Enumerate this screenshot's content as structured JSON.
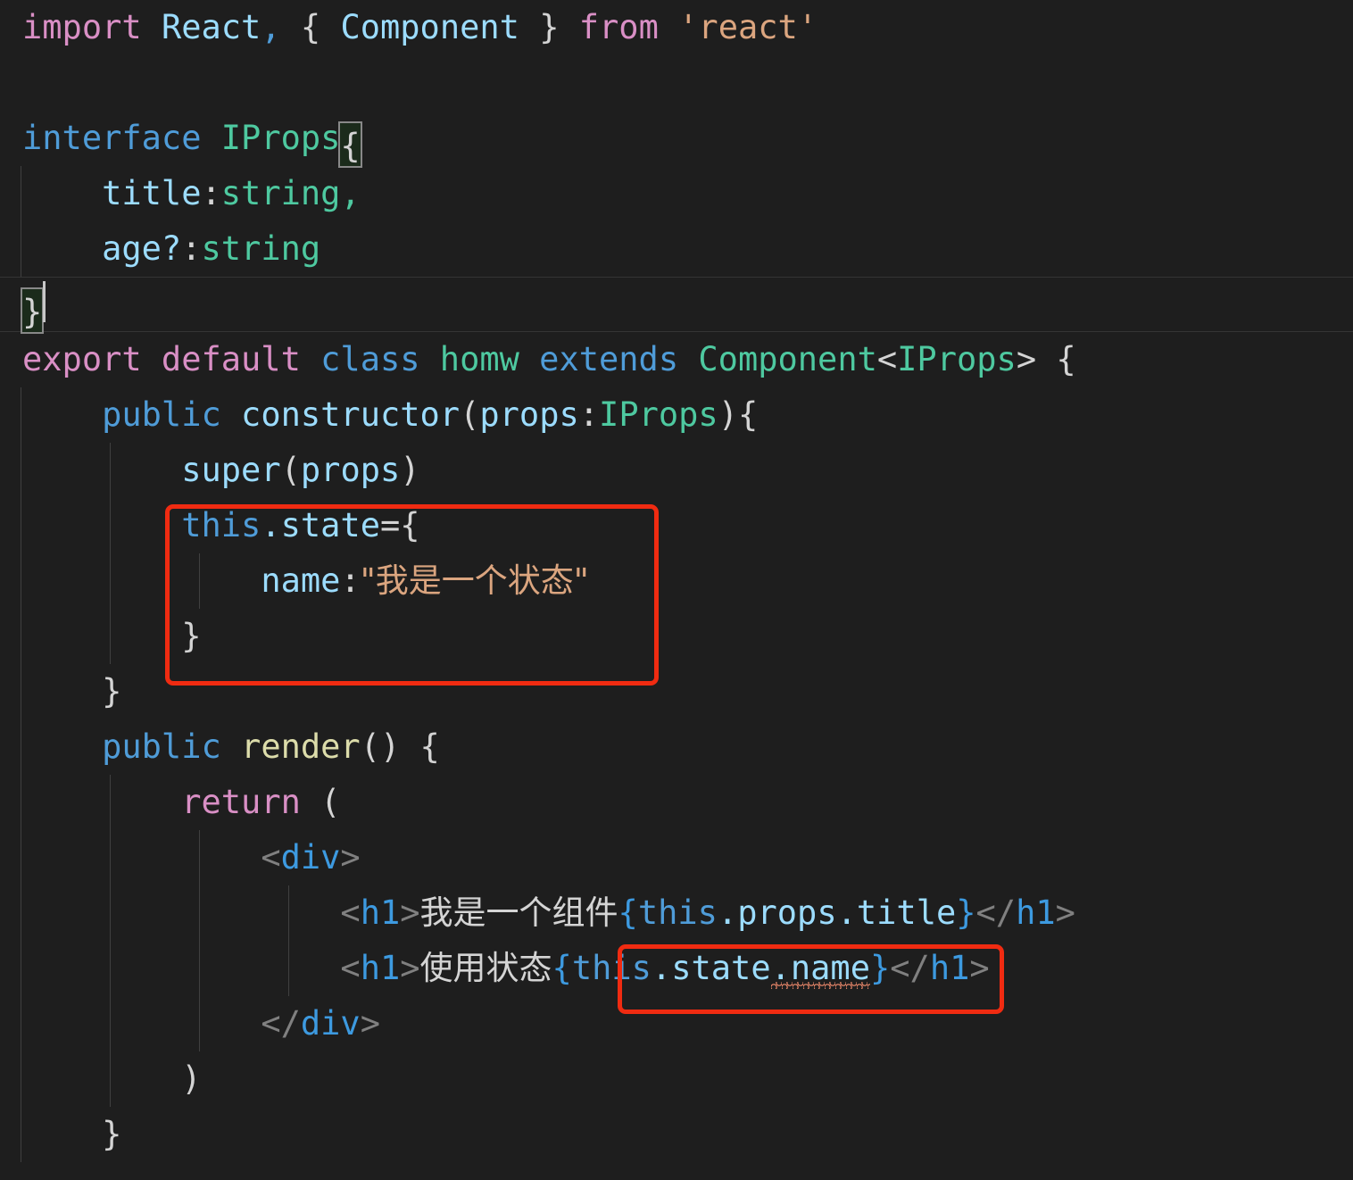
{
  "editor": {
    "theme_background": "#1e1e1e",
    "language": "TypeScript React",
    "font_size_px": 37,
    "line_height_px": 62,
    "colors": {
      "background": "#1e1e1e",
      "default_text": "#d4d4d4",
      "keyword": "#d98fc5",
      "control_keyword": "#4f9cd8",
      "type": "#4ec9a0",
      "identifier": "#9cdcfe",
      "function": "#dcdcaa",
      "string": "#dba57f",
      "tag_bracket": "#808080",
      "tag_name": "#3d9ae0",
      "indent_guide": "#404040",
      "current_line_border": "#353535",
      "bracket_match_border": "#888888",
      "bracket_match_fill": "#1b2b1b",
      "annotation_red": "#f02b11",
      "error_squiggle": "#f08a6c"
    }
  },
  "code": {
    "line_01": {
      "t1": "import ",
      "t2": "React",
      "t3": ",",
      "t4": " { ",
      "t5": "Component",
      "t6": " } ",
      "t7": "from ",
      "t8": "'react'"
    },
    "line_02": {
      "blank": ""
    },
    "line_03": {
      "t1": "interface ",
      "t2": "IProps",
      "t3": "{"
    },
    "line_04": {
      "t1": "    ",
      "t2": "title",
      "t3": ":",
      "t4": "string",
      "t5": ","
    },
    "line_05": {
      "t1": "    ",
      "t2": "age?",
      "t3": ":",
      "t4": "string"
    },
    "line_06": {
      "t1": "}"
    },
    "line_07": {
      "t1": "export default ",
      "t2": "class ",
      "t3": "homw",
      "t4": " extends ",
      "t5": "Component",
      "t6": "<",
      "t7": "IProps",
      "t8": "> {"
    },
    "line_08": {
      "t1": "    ",
      "t2": "public ",
      "t3": "constructor",
      "t4": "(",
      "t5": "props",
      "t6": ":",
      "t7": "IProps",
      "t8": "){"
    },
    "line_09": {
      "t1": "        ",
      "t2": "super",
      "t3": "(",
      "t4": "props",
      "t5": ")"
    },
    "line_10": {
      "t1": "        ",
      "t2": "this",
      "t3": ".state",
      "t4": "=",
      "t5": "{"
    },
    "line_11": {
      "t1": "            ",
      "t2": "name",
      "t3": ":",
      "t4": "\"我是一个状态\""
    },
    "line_12": {
      "t1": "        ",
      "t2": "}"
    },
    "line_13": {
      "t1": "    ",
      "t2": "}"
    },
    "line_14": {
      "t1": "    ",
      "t2": "public ",
      "t3": "render",
      "t4": "() {"
    },
    "line_15": {
      "t1": "        ",
      "t2": "return",
      "t3": " ("
    },
    "line_16": {
      "t1": "            ",
      "t2": "<",
      "t3": "div",
      "t4": ">"
    },
    "line_17": {
      "t1": "                ",
      "t2": "<",
      "t3": "h1",
      "t4": ">",
      "t5": "我是一个组件",
      "t6": "{",
      "t7": "this",
      "t8": ".props",
      "t9": ".title",
      "t10": "}",
      "t11": "</",
      "t12": "h1",
      "t13": ">"
    },
    "line_18": {
      "t1": "                ",
      "t2": "<",
      "t3": "h1",
      "t4": ">",
      "t5": "使用状态",
      "t6": "{",
      "t7": "this",
      "t8": ".state",
      "t9": ".name",
      "t10": "}",
      "t11": "</",
      "t12": "h1",
      "t13": ">"
    },
    "line_19": {
      "t1": "            ",
      "t2": "</",
      "t3": "div",
      "t4": ">"
    },
    "line_20": {
      "t1": "        ",
      "t2": ")"
    },
    "line_21": {
      "t1": "    ",
      "t2": "}"
    }
  },
  "annotations": {
    "box_1": {
      "label": "this.state assignment highlight",
      "color": "#f02b11"
    },
    "box_2": {
      "label": "this.state.name usage highlight",
      "color": "#f02b11"
    }
  },
  "markers": {
    "bracket_match_open": "{",
    "bracket_match_close": "}",
    "error_underline_token": "name"
  }
}
